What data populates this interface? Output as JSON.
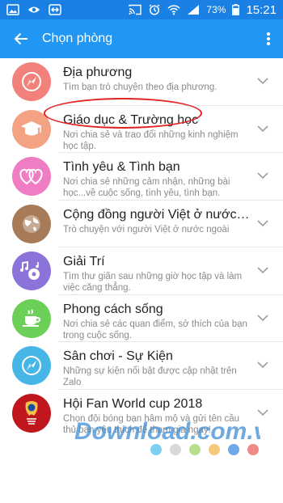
{
  "status_bar": {
    "battery": "73%",
    "time": "15:21"
  },
  "app_bar": {
    "title": "Chọn phòng"
  },
  "rooms": [
    {
      "name": "Địa phương",
      "desc": "Tìm bạn trò chuyện theo địa phương.",
      "icon": "compass-icon",
      "color": "#f2817b"
    },
    {
      "name": "Giáo dục & Trường học",
      "desc": "Nơi chia sẻ và trao đổi những kinh nghiệm học tập.",
      "icon": "graduation-cap-icon",
      "color": "#f3a283"
    },
    {
      "name": "Tình yêu & Tình bạn",
      "desc": "Nơi chia sẻ những cảm nhận, những bài học...về cuộc sống, tình yêu, tình bạn.",
      "icon": "hearts-icon",
      "color": "#f07cc4"
    },
    {
      "name": "Cộng đồng người Việt ở nước n...",
      "desc": "Trò chuyện với người Việt ở nước ngoài",
      "icon": "globe-icon",
      "color": "#a87b58"
    },
    {
      "name": "Giải Trí",
      "desc": "Tìm thư giãn sau những giờ học tập và làm việc căng thẳng.",
      "icon": "music-notes-icon",
      "color": "#8b73d9"
    },
    {
      "name": "Phong cách sống",
      "desc": "Nơi chia sẻ các quan điểm, sở thích của bạn trong cuộc sống.",
      "icon": "coffee-cup-icon",
      "color": "#6ccf58"
    },
    {
      "name": "Sân chơi - Sự Kiện",
      "desc": "Những sự kiện nổi bật được cập nhật trên Zalo",
      "icon": "compass-icon",
      "color": "#46b6e6"
    },
    {
      "name": "Hội Fan World cup 2018",
      "desc": "Chọn đội bóng bạn hâm mộ và gửi tên cầu thủ bạn yêu thích để tham gia ngay!",
      "icon": "world-cup-logo-icon",
      "color": "#c0161d"
    }
  ],
  "watermark": "Download.com.vn",
  "page_dots": [
    "#7fd0f0",
    "#d8d8d8",
    "#b7e08e",
    "#f5c97a",
    "#6fa9e8",
    "#f08a8a"
  ]
}
